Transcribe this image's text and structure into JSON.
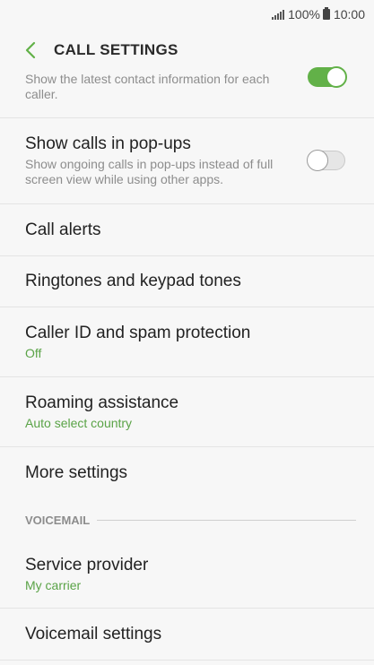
{
  "status_bar": {
    "battery": "100%",
    "time": "10:00"
  },
  "header": {
    "title": "CALL SETTINGS"
  },
  "rows": {
    "contact_info": {
      "sub": "Show the latest contact information for each caller.",
      "toggle_on": true
    },
    "popups": {
      "title": "Show calls in pop-ups",
      "sub": "Show ongoing calls in pop-ups instead of full screen view while using other apps.",
      "toggle_on": false
    },
    "call_alerts": {
      "title": "Call alerts"
    },
    "ringtones": {
      "title": "Ringtones and keypad tones"
    },
    "caller_id": {
      "title": "Caller ID and spam protection",
      "value": "Off"
    },
    "roaming": {
      "title": "Roaming assistance",
      "value": "Auto select country"
    },
    "more": {
      "title": "More settings"
    },
    "voicemail_header": "VOICEMAIL",
    "service_provider": {
      "title": "Service provider",
      "value": "My carrier"
    },
    "voicemail_settings": {
      "title": "Voicemail settings"
    }
  },
  "colors": {
    "accent": "#62b148",
    "value_text": "#5aa347",
    "background": "#f7f7f7"
  }
}
